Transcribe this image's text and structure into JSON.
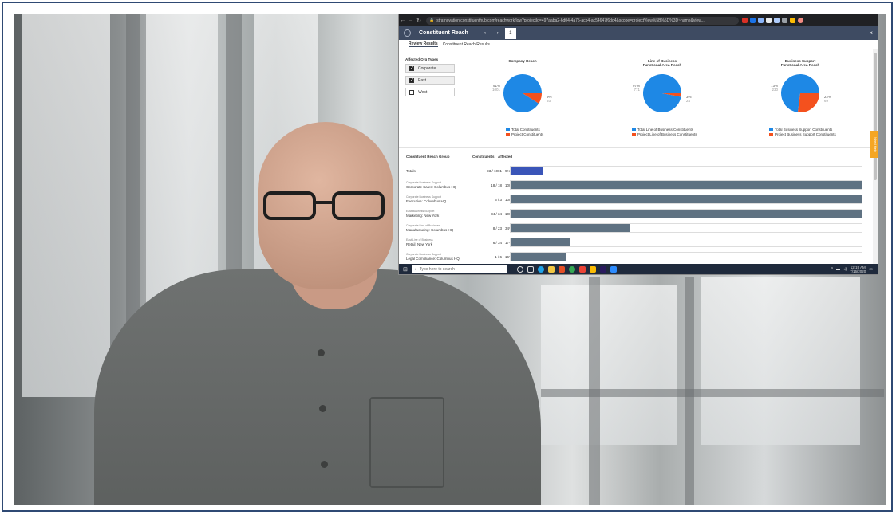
{
  "browser": {
    "url": "stratnovation.constituenthub.com/reachworkflow?projectId=497aaba2-6d04-4a75-acb4-ac54647f6dd4&scope=projectView%5B%5D%3D~name&view..."
  },
  "app": {
    "title": "Constituent Reach",
    "pager": {
      "prev": "‹",
      "next": "›",
      "page": "1"
    },
    "close": "×"
  },
  "tabs": [
    {
      "label": "Review Results",
      "active": true
    },
    {
      "label": "Constituent Reach Results",
      "active": false
    }
  ],
  "filters": {
    "heading": "Affected Org Types",
    "items": [
      {
        "label": "Corporate",
        "checked": true
      },
      {
        "label": "East",
        "checked": true
      },
      {
        "label": "West",
        "checked": false
      }
    ]
  },
  "pies": [
    {
      "title": "Company Reach",
      "slices": [
        {
          "label": "91%",
          "sublabel": "1001",
          "value": 91,
          "color": "#1e88e5"
        },
        {
          "label": "9%",
          "sublabel": "93",
          "value": 9,
          "color": "#f4511e"
        }
      ],
      "legend": [
        "Total Constituents",
        "Project Constituents"
      ]
    },
    {
      "title": "Line of Business\nFunctional Area Reach",
      "slices": [
        {
          "label": "97%",
          "sublabel": "771",
          "value": 97,
          "color": "#1e88e5"
        },
        {
          "label": "3%",
          "sublabel": "24",
          "value": 3,
          "color": "#f4511e"
        }
      ],
      "legend": [
        "Total Line of Business Constituents",
        "Project Line of Business Constituents"
      ]
    },
    {
      "title": "Business Support\nFunctional Area Reach",
      "slices": [
        {
          "label": "73%",
          "sublabel": "230",
          "value": 73,
          "color": "#1e88e5"
        },
        {
          "label": "22%",
          "sublabel": "69",
          "value": 27,
          "color": "#f4511e"
        }
      ],
      "legend": [
        "Total Business Support Constituents",
        "Project Business Support Constituents"
      ]
    }
  ],
  "table": {
    "headers": {
      "group": "Constituent Reach Group",
      "constituents": "Constituents",
      "affected": "Affected"
    },
    "rows": [
      {
        "category": "",
        "name": "Totals",
        "count": "93 / 1001",
        "pct": "9%",
        "fill": 0.09,
        "total": true
      },
      {
        "category": "Corporate Business Support",
        "name": "Corporate Sales: Columbus HQ",
        "count": "18 / 18",
        "pct": "100%",
        "fill": 1.0
      },
      {
        "category": "Corporate Business Support",
        "name": "Executive: Columbus HQ",
        "count": "3 / 3",
        "pct": "100%",
        "fill": 1.0
      },
      {
        "category": "East Business Support",
        "name": "Marketing: New York",
        "count": "34 / 34",
        "pct": "100%",
        "fill": 1.0
      },
      {
        "category": "Corporate Line of Business",
        "name": "Manufacturing: Columbus HQ",
        "count": "8 / 23",
        "pct": "34%",
        "fill": 0.34
      },
      {
        "category": "East Line of Business",
        "name": "Retail: New York",
        "count": "6 / 34",
        "pct": "17%",
        "fill": 0.17
      },
      {
        "category": "Corporate Business Support",
        "name": "Legal Compliance: Columbus HQ",
        "count": "1 / 6",
        "pct": "16%",
        "fill": 0.16
      }
    ]
  },
  "sidetab": "Need Help",
  "taskbar": {
    "search_placeholder": "Type here to search",
    "time": "12:19 AM",
    "date": "7/16/2020"
  }
}
